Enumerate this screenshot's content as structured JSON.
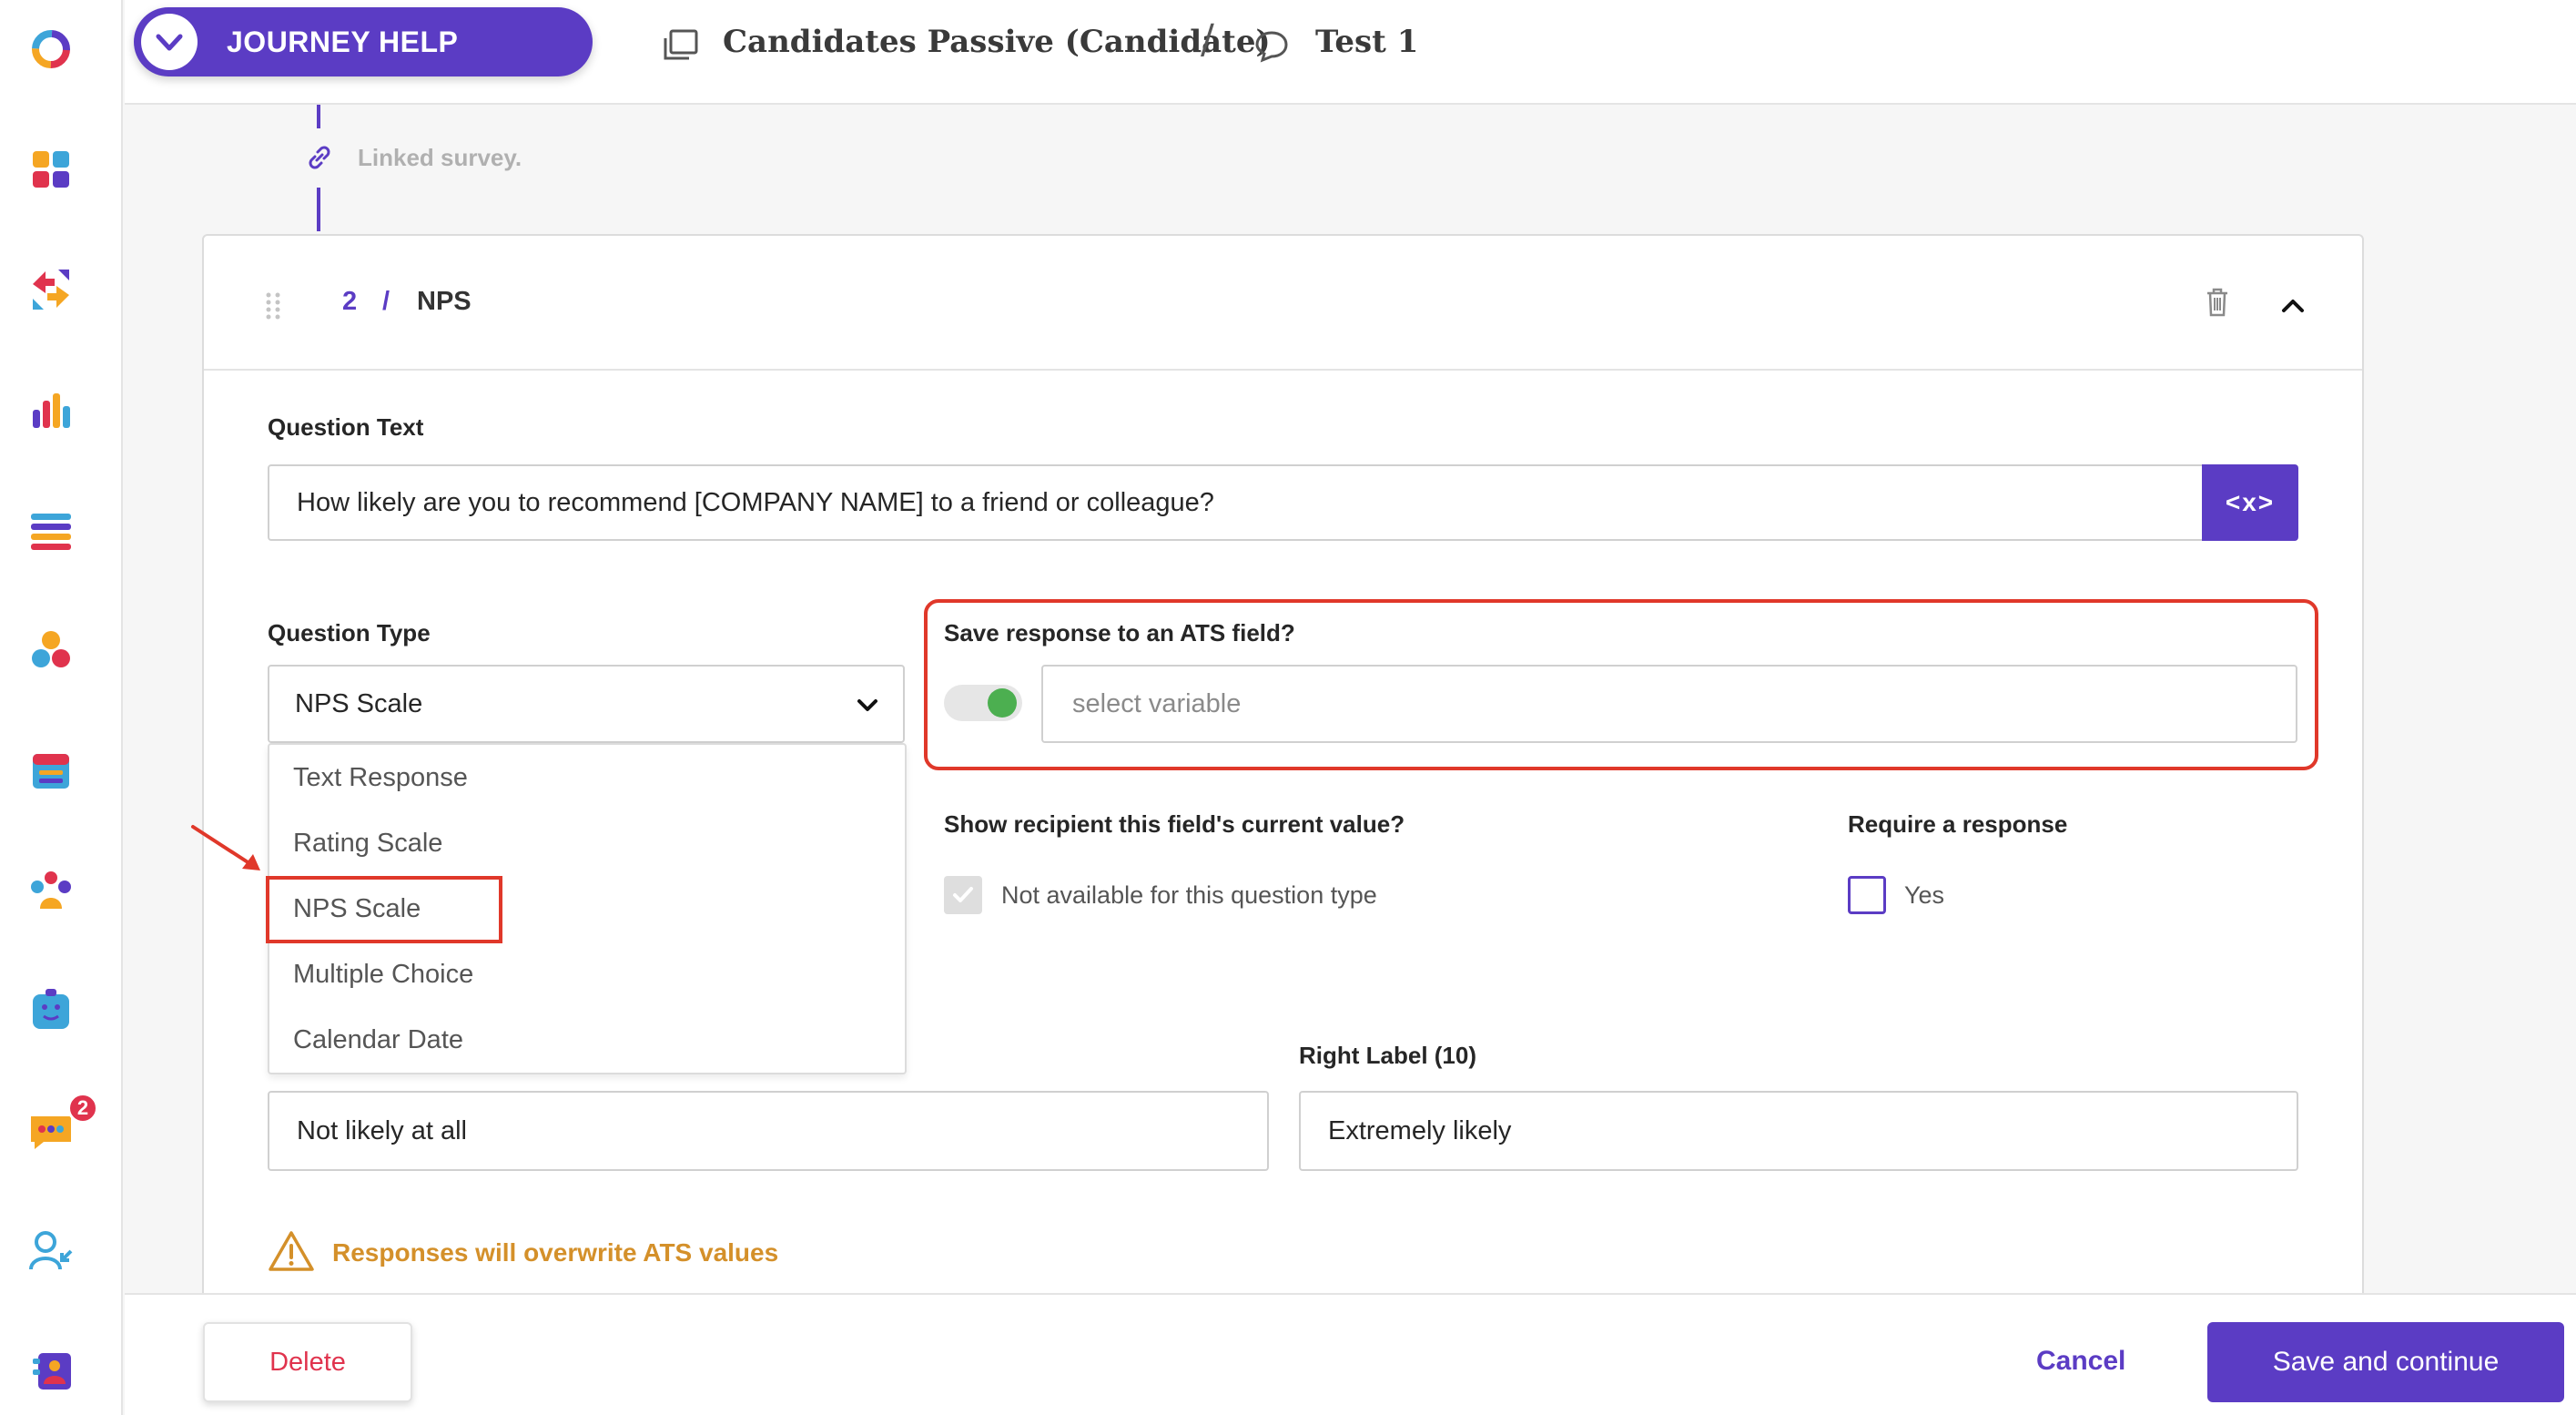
{
  "header": {
    "journey_help": "JOURNEY HELP",
    "crumb_candidates": "Candidates Passive (Candidate)",
    "crumb_separator": "/",
    "crumb_test": "Test 1"
  },
  "sidebar": {
    "badge_count": "2",
    "icons": [
      "logo-icon",
      "dashboard-icon",
      "journeys-icon",
      "analytics-icon",
      "lists-icon",
      "segments-icon",
      "calendar-icon",
      "team-icon",
      "bot-icon",
      "chat-icon",
      "user-import-icon",
      "contacts-icon"
    ]
  },
  "timeline": {
    "linked_survey": "Linked survey."
  },
  "question": {
    "number": "2",
    "separator": "/",
    "name": "NPS",
    "text_label": "Question Text",
    "text_value": "How likely are you to recommend [COMPANY NAME] to a friend or colleague?",
    "variable_button": "<x>",
    "type_label": "Question Type",
    "type_value": "NPS Scale",
    "type_options": [
      "Text Response",
      "Rating Scale",
      "NPS Scale",
      "Multiple Choice",
      "Calendar Date"
    ],
    "ats_label": "Save response to an ATS field?",
    "ats_toggle_on": true,
    "ats_placeholder": "select variable",
    "show_current_label": "Show recipient this field's current value?",
    "show_current_text": "Not available for this question type",
    "require_label": "Require a response",
    "require_text": "Yes",
    "left_label_value": "Not likely at all",
    "right_label_title": "Right Label (10)",
    "right_label_value": "Extremely likely",
    "warning": "Responses will overwrite ATS values"
  },
  "footer": {
    "delete": "Delete",
    "cancel": "Cancel",
    "save": "Save and continue"
  },
  "colors": {
    "accent": "#5b3cc4",
    "highlight": "#e0382a",
    "warning": "#d4902a",
    "danger": "#e0334d",
    "toggle_on": "#4caf50"
  }
}
